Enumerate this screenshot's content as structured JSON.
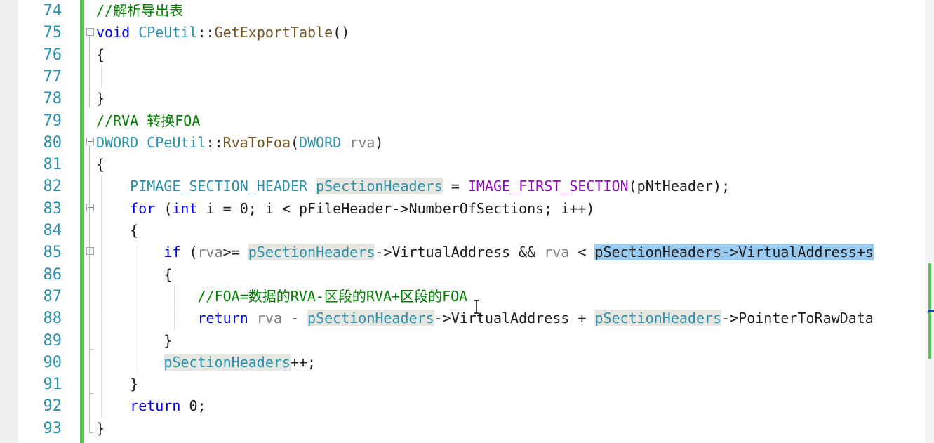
{
  "editor": {
    "colors": {
      "line_number": "#2b91af",
      "comment": "#008000",
      "keyword": "#0000ff",
      "type": "#2b91af",
      "function": "#74531f",
      "macro": "#8f08c4",
      "parameter": "#808080",
      "selection": "#99c9ef",
      "reference_highlight": "#e6e7e1",
      "change_bar": "#5cc35a"
    },
    "lines": [
      {
        "number": "74",
        "tokens": [
          {
            "text": "//解析导出表",
            "cls": "cm"
          }
        ]
      },
      {
        "number": "75",
        "tokens": [
          {
            "text": "void",
            "cls": "kw"
          },
          {
            "text": " "
          },
          {
            "text": "CPeUtil",
            "cls": "ty"
          },
          {
            "text": "::",
            "cls": "op"
          },
          {
            "text": "GetExportTable",
            "cls": "fn"
          },
          {
            "text": "()"
          }
        ]
      },
      {
        "number": "76",
        "tokens": [
          {
            "text": "{"
          }
        ]
      },
      {
        "number": "77",
        "tokens": []
      },
      {
        "number": "78",
        "tokens": [
          {
            "text": "}"
          }
        ]
      },
      {
        "number": "79",
        "tokens": [
          {
            "text": "//RVA 转换FOA",
            "cls": "cm"
          }
        ]
      },
      {
        "number": "80",
        "tokens": [
          {
            "text": "DWORD",
            "cls": "ty"
          },
          {
            "text": " "
          },
          {
            "text": "CPeUtil",
            "cls": "ty"
          },
          {
            "text": "::",
            "cls": "op"
          },
          {
            "text": "RvaToFoa",
            "cls": "fn"
          },
          {
            "text": "("
          },
          {
            "text": "DWORD",
            "cls": "ty"
          },
          {
            "text": " "
          },
          {
            "text": "rva",
            "cls": "prm"
          },
          {
            "text": ")"
          }
        ]
      },
      {
        "number": "81",
        "tokens": [
          {
            "text": "{"
          }
        ]
      },
      {
        "number": "82",
        "tokens": [
          {
            "text": "    "
          },
          {
            "text": "PIMAGE_SECTION_HEADER",
            "cls": "ty"
          },
          {
            "text": " "
          },
          {
            "text": "pSectionHeaders",
            "cls": "ty hl"
          },
          {
            "text": " = "
          },
          {
            "text": "IMAGE_FIRST_SECTION",
            "cls": "mac"
          },
          {
            "text": "(pNtHeader);"
          }
        ]
      },
      {
        "number": "83",
        "tokens": [
          {
            "text": "    "
          },
          {
            "text": "for",
            "cls": "kw"
          },
          {
            "text": " ("
          },
          {
            "text": "int",
            "cls": "kw"
          },
          {
            "text": " i = 0; i < pFileHeader->NumberOfSections; i++)"
          }
        ]
      },
      {
        "number": "84",
        "tokens": [
          {
            "text": "    {"
          }
        ]
      },
      {
        "number": "85",
        "tokens": [
          {
            "text": "        "
          },
          {
            "text": "if",
            "cls": "kw"
          },
          {
            "text": " ("
          },
          {
            "text": "rva",
            "cls": "prm"
          },
          {
            "text": ">= "
          },
          {
            "text": "pSectionHeaders",
            "cls": "ty hl"
          },
          {
            "text": "->VirtualAddress && "
          },
          {
            "text": "rva",
            "cls": "prm"
          },
          {
            "text": " < "
          },
          {
            "text": "pSectionHeaders->VirtualAddress+s",
            "cls": "sel seltext"
          }
        ]
      },
      {
        "number": "86",
        "tokens": [
          {
            "text": "        {"
          }
        ]
      },
      {
        "number": "87",
        "tokens": [
          {
            "text": "            "
          },
          {
            "text": "//FOA=数据的RVA-区段的RVA+区段的FOA",
            "cls": "cm"
          }
        ]
      },
      {
        "number": "88",
        "tokens": [
          {
            "text": "            "
          },
          {
            "text": "return",
            "cls": "kw"
          },
          {
            "text": " "
          },
          {
            "text": "rva",
            "cls": "prm"
          },
          {
            "text": " - "
          },
          {
            "text": "pSectionHeaders",
            "cls": "ty hl"
          },
          {
            "text": "->VirtualAddress + "
          },
          {
            "text": "pSectionHeaders",
            "cls": "ty hl"
          },
          {
            "text": "->PointerToRawData"
          }
        ]
      },
      {
        "number": "89",
        "tokens": [
          {
            "text": "        }"
          }
        ]
      },
      {
        "number": "90",
        "tokens": [
          {
            "text": "        "
          },
          {
            "text": "pSectionHeaders",
            "cls": "ty hl"
          },
          {
            "text": "++;"
          }
        ]
      },
      {
        "number": "91",
        "tokens": [
          {
            "text": "    }"
          }
        ]
      },
      {
        "number": "92",
        "tokens": [
          {
            "text": "    "
          },
          {
            "text": "return",
            "cls": "kw"
          },
          {
            "text": " 0;"
          }
        ]
      },
      {
        "number": "93",
        "tokens": [
          {
            "text": "}"
          }
        ]
      }
    ]
  }
}
